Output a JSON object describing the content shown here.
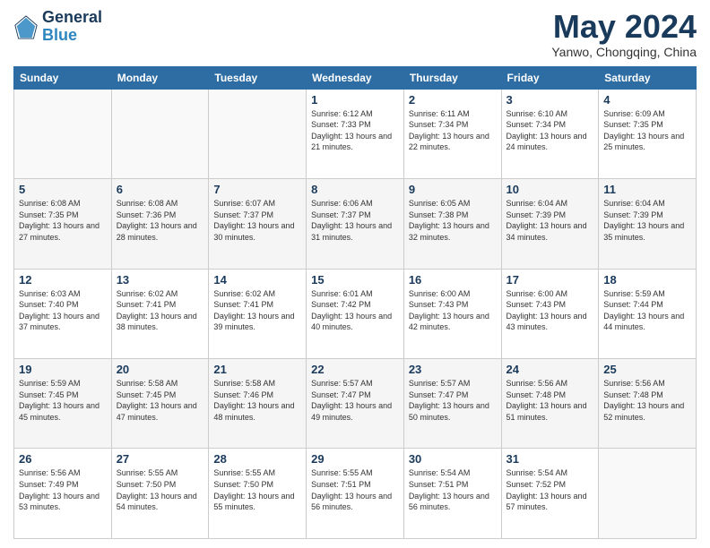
{
  "logo": {
    "line1": "General",
    "line2": "Blue"
  },
  "title": "May 2024",
  "subtitle": "Yanwo, Chongqing, China",
  "days_of_week": [
    "Sunday",
    "Monday",
    "Tuesday",
    "Wednesday",
    "Thursday",
    "Friday",
    "Saturday"
  ],
  "weeks": [
    [
      {
        "day": "",
        "sunrise": "",
        "sunset": "",
        "daylight": ""
      },
      {
        "day": "",
        "sunrise": "",
        "sunset": "",
        "daylight": ""
      },
      {
        "day": "",
        "sunrise": "",
        "sunset": "",
        "daylight": ""
      },
      {
        "day": "1",
        "sunrise": "Sunrise: 6:12 AM",
        "sunset": "Sunset: 7:33 PM",
        "daylight": "Daylight: 13 hours and 21 minutes."
      },
      {
        "day": "2",
        "sunrise": "Sunrise: 6:11 AM",
        "sunset": "Sunset: 7:34 PM",
        "daylight": "Daylight: 13 hours and 22 minutes."
      },
      {
        "day": "3",
        "sunrise": "Sunrise: 6:10 AM",
        "sunset": "Sunset: 7:34 PM",
        "daylight": "Daylight: 13 hours and 24 minutes."
      },
      {
        "day": "4",
        "sunrise": "Sunrise: 6:09 AM",
        "sunset": "Sunset: 7:35 PM",
        "daylight": "Daylight: 13 hours and 25 minutes."
      }
    ],
    [
      {
        "day": "5",
        "sunrise": "Sunrise: 6:08 AM",
        "sunset": "Sunset: 7:35 PM",
        "daylight": "Daylight: 13 hours and 27 minutes."
      },
      {
        "day": "6",
        "sunrise": "Sunrise: 6:08 AM",
        "sunset": "Sunset: 7:36 PM",
        "daylight": "Daylight: 13 hours and 28 minutes."
      },
      {
        "day": "7",
        "sunrise": "Sunrise: 6:07 AM",
        "sunset": "Sunset: 7:37 PM",
        "daylight": "Daylight: 13 hours and 30 minutes."
      },
      {
        "day": "8",
        "sunrise": "Sunrise: 6:06 AM",
        "sunset": "Sunset: 7:37 PM",
        "daylight": "Daylight: 13 hours and 31 minutes."
      },
      {
        "day": "9",
        "sunrise": "Sunrise: 6:05 AM",
        "sunset": "Sunset: 7:38 PM",
        "daylight": "Daylight: 13 hours and 32 minutes."
      },
      {
        "day": "10",
        "sunrise": "Sunrise: 6:04 AM",
        "sunset": "Sunset: 7:39 PM",
        "daylight": "Daylight: 13 hours and 34 minutes."
      },
      {
        "day": "11",
        "sunrise": "Sunrise: 6:04 AM",
        "sunset": "Sunset: 7:39 PM",
        "daylight": "Daylight: 13 hours and 35 minutes."
      }
    ],
    [
      {
        "day": "12",
        "sunrise": "Sunrise: 6:03 AM",
        "sunset": "Sunset: 7:40 PM",
        "daylight": "Daylight: 13 hours and 37 minutes."
      },
      {
        "day": "13",
        "sunrise": "Sunrise: 6:02 AM",
        "sunset": "Sunset: 7:41 PM",
        "daylight": "Daylight: 13 hours and 38 minutes."
      },
      {
        "day": "14",
        "sunrise": "Sunrise: 6:02 AM",
        "sunset": "Sunset: 7:41 PM",
        "daylight": "Daylight: 13 hours and 39 minutes."
      },
      {
        "day": "15",
        "sunrise": "Sunrise: 6:01 AM",
        "sunset": "Sunset: 7:42 PM",
        "daylight": "Daylight: 13 hours and 40 minutes."
      },
      {
        "day": "16",
        "sunrise": "Sunrise: 6:00 AM",
        "sunset": "Sunset: 7:43 PM",
        "daylight": "Daylight: 13 hours and 42 minutes."
      },
      {
        "day": "17",
        "sunrise": "Sunrise: 6:00 AM",
        "sunset": "Sunset: 7:43 PM",
        "daylight": "Daylight: 13 hours and 43 minutes."
      },
      {
        "day": "18",
        "sunrise": "Sunrise: 5:59 AM",
        "sunset": "Sunset: 7:44 PM",
        "daylight": "Daylight: 13 hours and 44 minutes."
      }
    ],
    [
      {
        "day": "19",
        "sunrise": "Sunrise: 5:59 AM",
        "sunset": "Sunset: 7:45 PM",
        "daylight": "Daylight: 13 hours and 45 minutes."
      },
      {
        "day": "20",
        "sunrise": "Sunrise: 5:58 AM",
        "sunset": "Sunset: 7:45 PM",
        "daylight": "Daylight: 13 hours and 47 minutes."
      },
      {
        "day": "21",
        "sunrise": "Sunrise: 5:58 AM",
        "sunset": "Sunset: 7:46 PM",
        "daylight": "Daylight: 13 hours and 48 minutes."
      },
      {
        "day": "22",
        "sunrise": "Sunrise: 5:57 AM",
        "sunset": "Sunset: 7:47 PM",
        "daylight": "Daylight: 13 hours and 49 minutes."
      },
      {
        "day": "23",
        "sunrise": "Sunrise: 5:57 AM",
        "sunset": "Sunset: 7:47 PM",
        "daylight": "Daylight: 13 hours and 50 minutes."
      },
      {
        "day": "24",
        "sunrise": "Sunrise: 5:56 AM",
        "sunset": "Sunset: 7:48 PM",
        "daylight": "Daylight: 13 hours and 51 minutes."
      },
      {
        "day": "25",
        "sunrise": "Sunrise: 5:56 AM",
        "sunset": "Sunset: 7:48 PM",
        "daylight": "Daylight: 13 hours and 52 minutes."
      }
    ],
    [
      {
        "day": "26",
        "sunrise": "Sunrise: 5:56 AM",
        "sunset": "Sunset: 7:49 PM",
        "daylight": "Daylight: 13 hours and 53 minutes."
      },
      {
        "day": "27",
        "sunrise": "Sunrise: 5:55 AM",
        "sunset": "Sunset: 7:50 PM",
        "daylight": "Daylight: 13 hours and 54 minutes."
      },
      {
        "day": "28",
        "sunrise": "Sunrise: 5:55 AM",
        "sunset": "Sunset: 7:50 PM",
        "daylight": "Daylight: 13 hours and 55 minutes."
      },
      {
        "day": "29",
        "sunrise": "Sunrise: 5:55 AM",
        "sunset": "Sunset: 7:51 PM",
        "daylight": "Daylight: 13 hours and 56 minutes."
      },
      {
        "day": "30",
        "sunrise": "Sunrise: 5:54 AM",
        "sunset": "Sunset: 7:51 PM",
        "daylight": "Daylight: 13 hours and 56 minutes."
      },
      {
        "day": "31",
        "sunrise": "Sunrise: 5:54 AM",
        "sunset": "Sunset: 7:52 PM",
        "daylight": "Daylight: 13 hours and 57 minutes."
      },
      {
        "day": "",
        "sunrise": "",
        "sunset": "",
        "daylight": ""
      }
    ]
  ]
}
